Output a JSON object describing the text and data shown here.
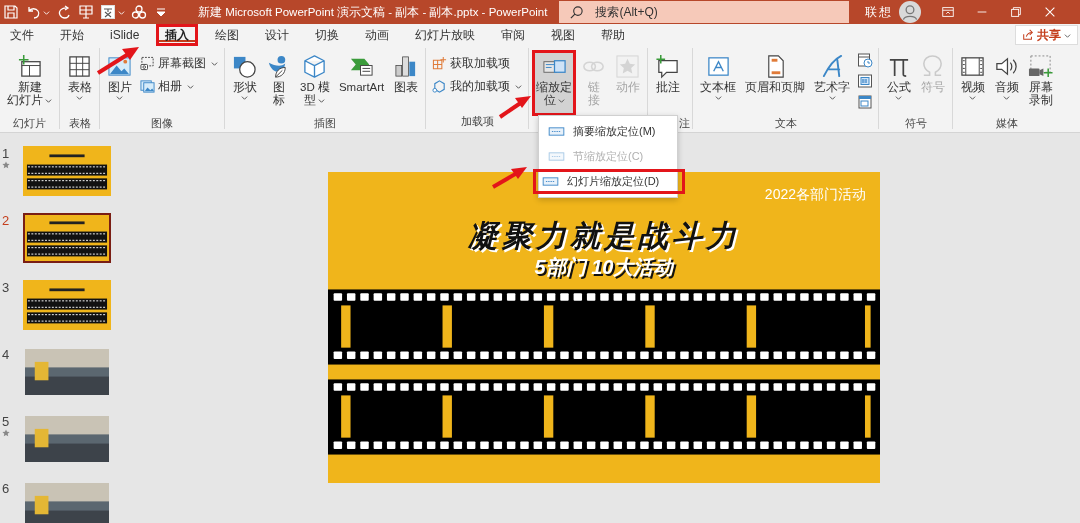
{
  "title_bar": {
    "document_title": "新建 Microsoft PowerPoint 演示文稿 - 副本 - 副本.pptx  -  PowerPoint",
    "search": {
      "placeholder": "搜索(Alt+Q)"
    },
    "user_name": "联想"
  },
  "tabs": [
    {
      "label": "文件",
      "selected": false,
      "highlighted": false
    },
    {
      "label": "开始",
      "selected": false,
      "highlighted": false
    },
    {
      "label": "iSlide",
      "selected": false,
      "highlighted": false
    },
    {
      "label": "插入",
      "selected": true,
      "highlighted": true
    },
    {
      "label": "绘图",
      "selected": false,
      "highlighted": false
    },
    {
      "label": "设计",
      "selected": false,
      "highlighted": false
    },
    {
      "label": "切换",
      "selected": false,
      "highlighted": false
    },
    {
      "label": "动画",
      "selected": false,
      "highlighted": false
    },
    {
      "label": "幻灯片放映",
      "selected": false,
      "highlighted": false
    },
    {
      "label": "审阅",
      "selected": false,
      "highlighted": false
    },
    {
      "label": "视图",
      "selected": false,
      "highlighted": false
    },
    {
      "label": "帮助",
      "selected": false,
      "highlighted": false
    }
  ],
  "share_button": {
    "label": "共享"
  },
  "ribbon": {
    "groups": [
      {
        "label": "幻灯片",
        "items": [
          {
            "kind": "large",
            "label": [
              "新建",
              "幻灯片"
            ],
            "dropdown": true,
            "disabled": false,
            "highlighted": false
          }
        ]
      },
      {
        "label": "表格",
        "items": [
          {
            "kind": "large",
            "label": "表格",
            "dropdown": true,
            "disabled": false,
            "highlighted": false
          }
        ]
      },
      {
        "label": "图像",
        "items": [
          {
            "kind": "large",
            "label": "图片",
            "dropdown": true,
            "disabled": false,
            "highlighted": false
          },
          {
            "kind": "stack",
            "items": [
              {
                "label": "屏幕截图",
                "dropdown": true
              },
              {
                "label": "相册",
                "dropdown": true
              }
            ]
          }
        ]
      },
      {
        "label": "插图",
        "items": [
          {
            "kind": "large",
            "label": "形状",
            "dropdown": true,
            "disabled": false,
            "highlighted": false
          },
          {
            "kind": "large",
            "label": [
              "图",
              "标"
            ],
            "dropdown": false,
            "disabled": false,
            "highlighted": false
          },
          {
            "kind": "large",
            "label": [
              "3D 模",
              "型"
            ],
            "dropdown": true,
            "disabled": false,
            "highlighted": false
          },
          {
            "kind": "large",
            "label": "SmartArt",
            "dropdown": false,
            "disabled": false,
            "highlighted": false
          },
          {
            "kind": "large",
            "label": "图表",
            "dropdown": false,
            "disabled": false,
            "highlighted": false
          }
        ]
      },
      {
        "label": "加载项",
        "items": [
          {
            "kind": "stack",
            "items": [
              {
                "label": "获取加载项",
                "dropdown": false
              },
              {
                "label": "我的加载项",
                "dropdown": true
              }
            ]
          }
        ]
      },
      {
        "items": [
          {
            "kind": "large",
            "label": [
              "缩放定",
              "位"
            ],
            "dropdown": true,
            "disabled": false,
            "highlighted": true
          },
          {
            "kind": "large",
            "label": [
              "链",
              "接"
            ],
            "dropdown": false,
            "disabled": true,
            "highlighted": false
          },
          {
            "kind": "large",
            "label": "动作",
            "dropdown": false,
            "disabled": true,
            "highlighted": false
          }
        ]
      },
      {
        "label": "注",
        "items": [
          {
            "kind": "large",
            "label": "批注",
            "dropdown": false,
            "disabled": false,
            "highlighted": false
          }
        ]
      },
      {
        "label": "文本",
        "items": [
          {
            "kind": "large",
            "label": "文本框",
            "dropdown": true,
            "disabled": false,
            "highlighted": false
          },
          {
            "kind": "large",
            "label": "页眉和页脚",
            "dropdown": false,
            "disabled": false,
            "highlighted": false
          },
          {
            "kind": "large",
            "label": "艺术字",
            "dropdown": true,
            "disabled": false,
            "highlighted": false
          },
          {
            "kind": "icon-stack"
          }
        ]
      },
      {
        "label": "符号",
        "items": [
          {
            "kind": "large",
            "label": "公式",
            "dropdown": true,
            "disabled": false,
            "highlighted": false
          },
          {
            "kind": "large",
            "label": "符号",
            "dropdown": false,
            "disabled": true,
            "highlighted": false
          }
        ]
      },
      {
        "label": "媒体",
        "items": [
          {
            "kind": "large",
            "label": "视频",
            "dropdown": true,
            "disabled": false,
            "highlighted": false
          },
          {
            "kind": "large",
            "label": "音频",
            "dropdown": true,
            "disabled": false,
            "highlighted": false
          },
          {
            "kind": "large",
            "label": [
              "屏幕",
              "录制"
            ],
            "dropdown": false,
            "disabled": false,
            "highlighted": false
          }
        ]
      }
    ]
  },
  "zoom_menu": {
    "items": [
      {
        "label": "摘要缩放定位(M)",
        "disabled": false,
        "highlighted": false
      },
      {
        "label": "节缩放定位(C)",
        "disabled": true,
        "highlighted": false
      },
      {
        "label": "幻灯片缩放定位(D)",
        "disabled": false,
        "highlighted": true
      }
    ]
  },
  "slides_panel": {
    "slides": [
      {
        "number": "1",
        "selected": false,
        "transition_mark": true,
        "kind": "film"
      },
      {
        "number": "2",
        "selected": true,
        "transition_mark": false,
        "kind": "film"
      },
      {
        "number": "3",
        "selected": false,
        "transition_mark": false,
        "kind": "film"
      },
      {
        "number": "4",
        "selected": false,
        "transition_mark": false,
        "kind": "photo"
      },
      {
        "number": "5",
        "selected": false,
        "transition_mark": true,
        "kind": "photo"
      },
      {
        "number": "6",
        "selected": false,
        "transition_mark": false,
        "kind": "photo"
      }
    ]
  },
  "slide": {
    "tag": "2022各部门活动",
    "title": "凝聚力就是战斗力",
    "subtitle": "5部门 10大活动"
  }
}
